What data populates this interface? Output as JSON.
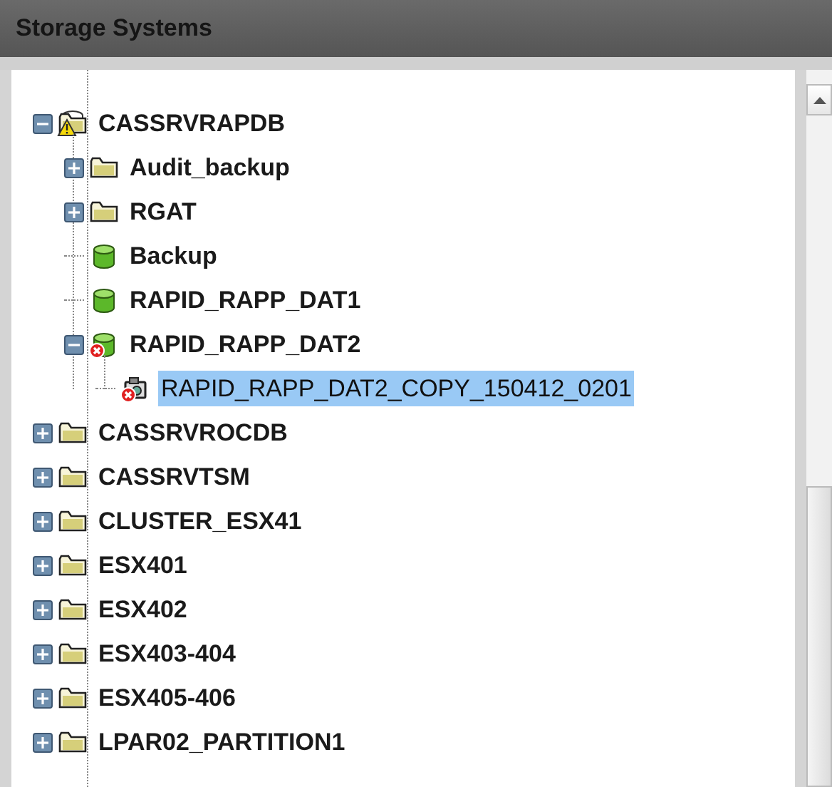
{
  "panel": {
    "title": "Storage Systems"
  },
  "tree": [
    {
      "label": "CASSRVRAPDB",
      "kind": "server",
      "warning": true,
      "error": false,
      "expanded": true,
      "selected": false,
      "children": [
        {
          "label": "Audit_backup",
          "kind": "folder",
          "warning": false,
          "error": false,
          "expanded": false,
          "selected": false
        },
        {
          "label": "RGAT",
          "kind": "folder",
          "warning": false,
          "error": false,
          "expanded": false,
          "selected": false
        },
        {
          "label": "Backup",
          "kind": "volume",
          "warning": false,
          "error": false,
          "selected": false
        },
        {
          "label": "RAPID_RAPP_DAT1",
          "kind": "volume",
          "warning": false,
          "error": false,
          "selected": false
        },
        {
          "label": "RAPID_RAPP_DAT2",
          "kind": "volume",
          "warning": false,
          "error": true,
          "expanded": true,
          "selected": false,
          "children": [
            {
              "label": "RAPID_RAPP_DAT2_COPY_150412_0201",
              "kind": "snapshot",
              "warning": false,
              "error": true,
              "selected": true
            }
          ]
        }
      ]
    },
    {
      "label": "CASSRVROCDB",
      "kind": "folder",
      "warning": false,
      "error": false,
      "expanded": false,
      "selected": false
    },
    {
      "label": "CASSRVTSM",
      "kind": "folder",
      "warning": false,
      "error": false,
      "expanded": false,
      "selected": false
    },
    {
      "label": "CLUSTER_ESX41",
      "kind": "folder",
      "warning": false,
      "error": false,
      "expanded": false,
      "selected": false
    },
    {
      "label": "ESX401",
      "kind": "folder",
      "warning": false,
      "error": false,
      "expanded": false,
      "selected": false
    },
    {
      "label": "ESX402",
      "kind": "folder",
      "warning": false,
      "error": false,
      "expanded": false,
      "selected": false
    },
    {
      "label": "ESX403-404",
      "kind": "folder",
      "warning": false,
      "error": false,
      "expanded": false,
      "selected": false
    },
    {
      "label": "ESX405-406",
      "kind": "folder",
      "warning": false,
      "error": false,
      "expanded": false,
      "selected": false
    },
    {
      "label": "LPAR02_PARTITION1",
      "kind": "folder",
      "warning": false,
      "error": false,
      "expanded": false,
      "selected": false
    }
  ]
}
